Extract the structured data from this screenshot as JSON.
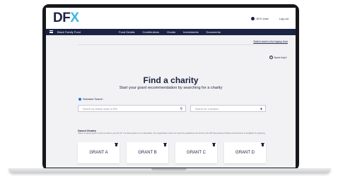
{
  "header": {
    "logo_letters": [
      "D",
      "F",
      "X"
    ],
    "user_name": "DFX User",
    "logout_label": "Log out"
  },
  "nav": {
    "fund_name": "Black Family Fund",
    "tabs": [
      "Fund Details",
      "Contributions",
      "Grants",
      "Investments",
      "Documents"
    ]
  },
  "page": {
    "legacy_link": "Switch back to the legacy form",
    "help_label": "Need help?",
    "title": "Find a charity",
    "subtitle": "Start your grant recommendation by searching for a charity",
    "search_mode_label": "Standard Search",
    "search_placeholder": "Search by charity name or EIN",
    "location_placeholder": "Search for a location",
    "saved_grants_heading": "Saved Grants",
    "saved_grants_desc": "Select a saved grant to pick up where you left off. If a saved grant is not selectable, the organization does not meet the guidelines set forth by the NIP Sponsoring Charity and therefore is ineligible for granting.",
    "saved_grants": [
      "GRANT A",
      "GRANT B",
      "GRANT C",
      "GRANT D"
    ]
  },
  "colors": {
    "brand_navy": "#1c2240",
    "brand_blue": "#3bb6e6",
    "nav_bg": "#1b2445"
  }
}
